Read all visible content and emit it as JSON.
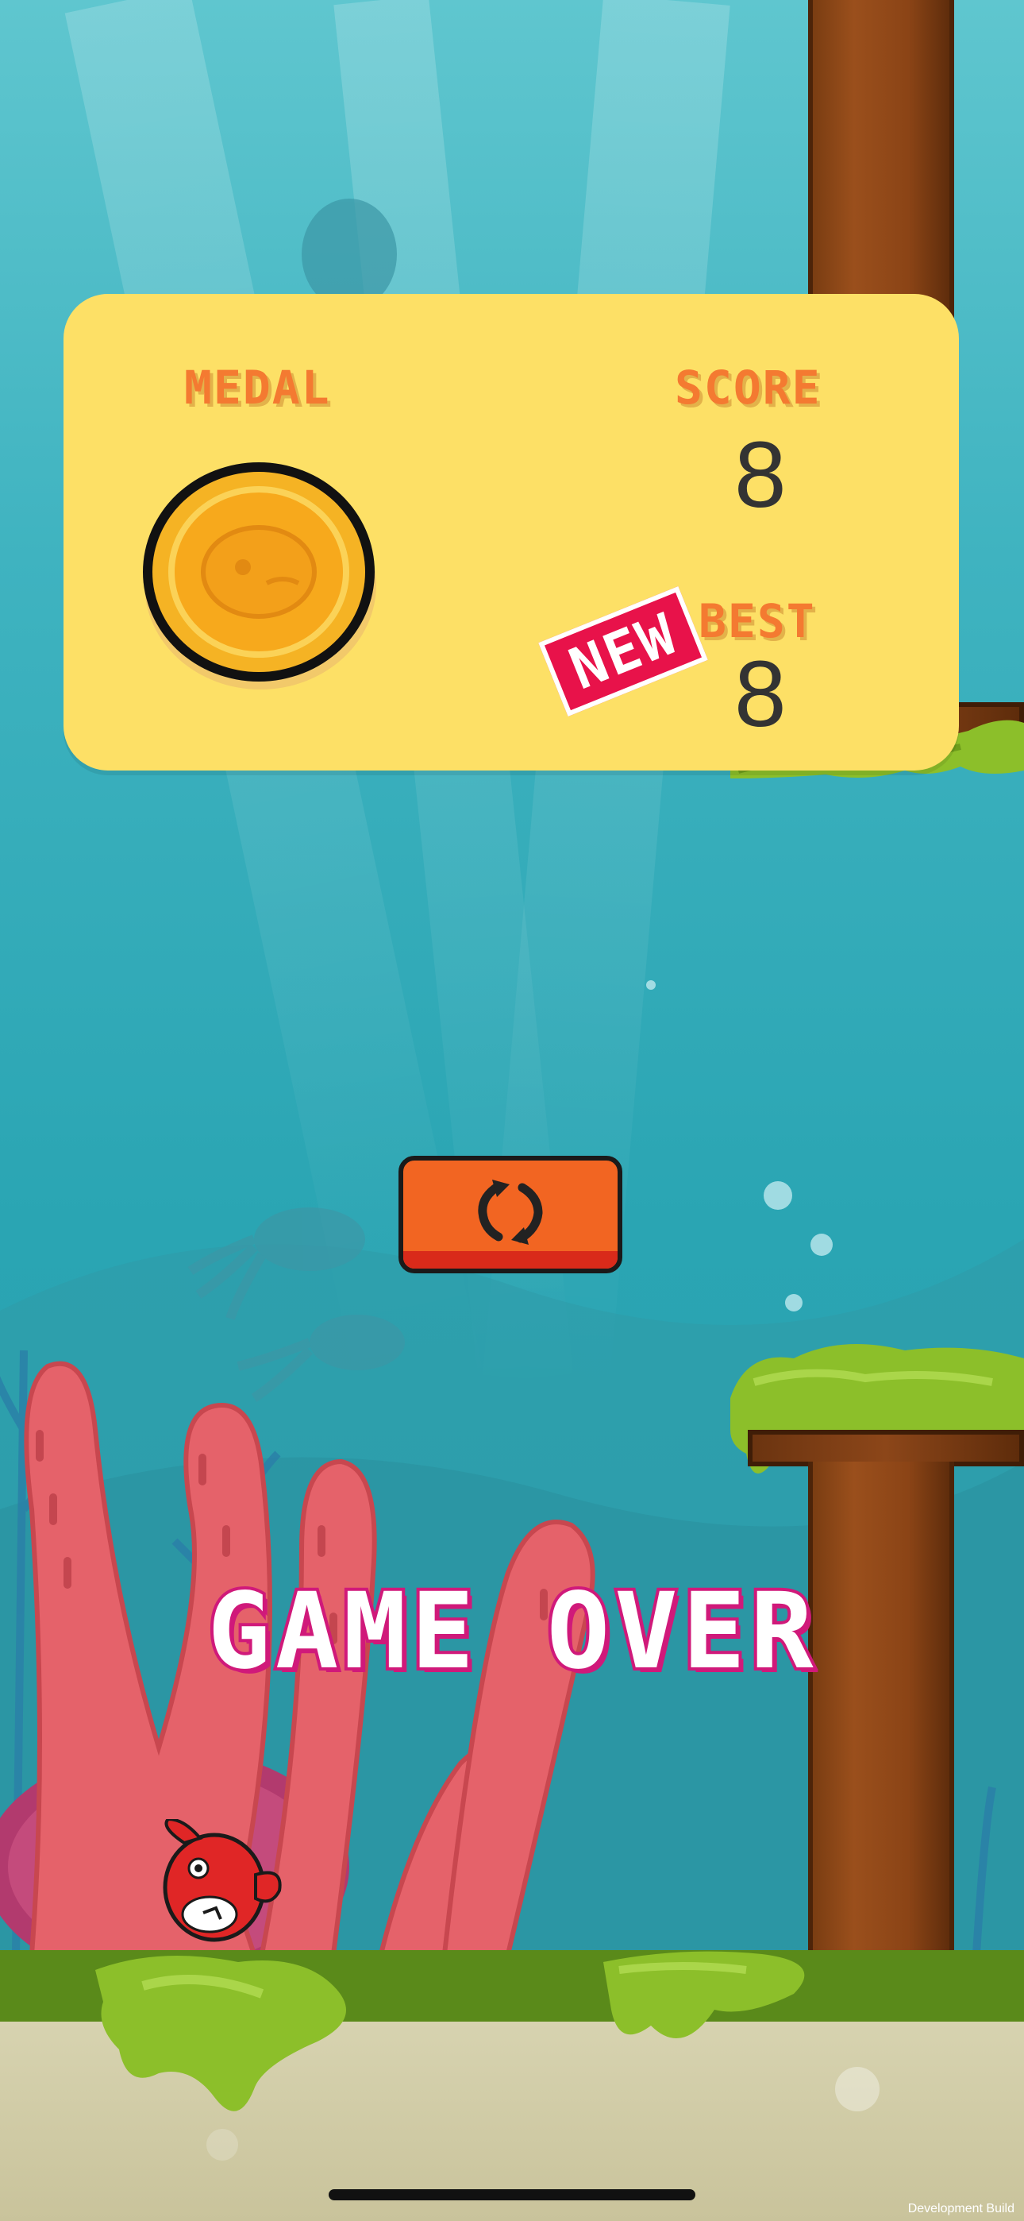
{
  "panel": {
    "medal_label": "MEDAL",
    "score_label": "SCORE",
    "score_value": "8",
    "best_label": "BEST",
    "best_value": "8",
    "new_badge": "NEW"
  },
  "game_over_text": "GAME OVER",
  "replay_button": {
    "icon": "refresh-icon"
  },
  "footer": {
    "dev_build": "Development Build"
  },
  "colors": {
    "panel_bg": "#fde066",
    "label": "#f47a31",
    "button": "#f26522",
    "game_over_stroke": "#d0197a",
    "new_badge": "#e8124a"
  }
}
